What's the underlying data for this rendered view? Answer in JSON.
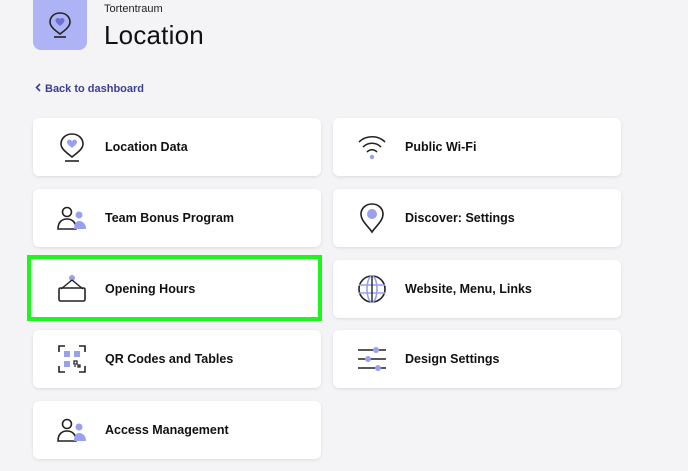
{
  "header": {
    "subtitle": "Tortentraum",
    "title": "Location",
    "icon": "location-heart-icon",
    "icon_bg": "#aeb3f5"
  },
  "back_link": {
    "label": "Back to dashboard",
    "color": "#3b3f91"
  },
  "cards": [
    {
      "label": "Location Data",
      "icon": "location-heart-icon"
    },
    {
      "label": "Public Wi-Fi",
      "icon": "wifi-icon"
    },
    {
      "label": "Team Bonus Program",
      "icon": "team-icon"
    },
    {
      "label": "Discover: Settings",
      "icon": "map-pin-icon"
    },
    {
      "label": "Opening Hours",
      "icon": "hanging-sign-icon"
    },
    {
      "label": "Website, Menu, Links",
      "icon": "globe-icon"
    },
    {
      "label": "QR Codes and Tables",
      "icon": "qr-code-icon"
    },
    {
      "label": "Design Settings",
      "icon": "sliders-icon"
    },
    {
      "label": "Access Management",
      "icon": "users-icon"
    }
  ],
  "colors": {
    "accent": "#aeb3f5",
    "highlight": "#1df51d"
  }
}
